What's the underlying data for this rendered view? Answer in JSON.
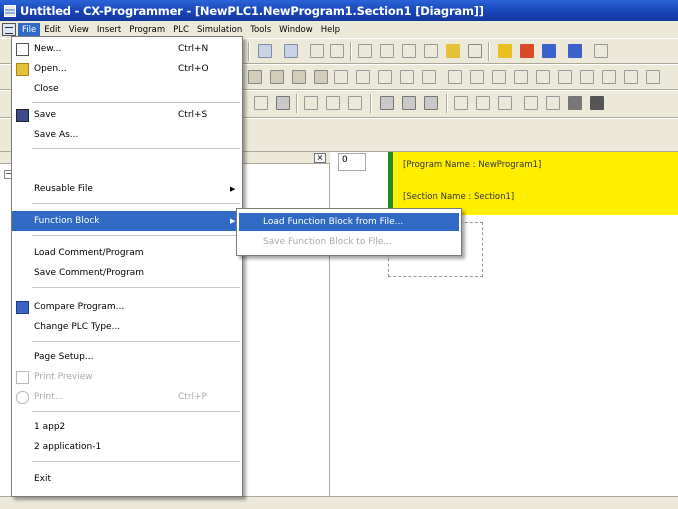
{
  "window": {
    "title": "Untitled - CX-Programmer - [NewPLC1.NewProgram1.Section1 [Diagram]]"
  },
  "menubar": [
    "File",
    "Edit",
    "View",
    "Insert",
    "Program",
    "PLC",
    "Simulation",
    "Tools",
    "Window",
    "Help"
  ],
  "file_menu": {
    "new": {
      "label": "New...",
      "shortcut": "Ctrl+N"
    },
    "open": {
      "label": "Open...",
      "shortcut": "Ctrl+O"
    },
    "close": {
      "label": "Close"
    },
    "save": {
      "label": "Save",
      "shortcut": "Ctrl+S"
    },
    "save_as": {
      "label": "Save As..."
    },
    "reusable_file": {
      "label": "Reusable File"
    },
    "function_block": {
      "label": "Function Block"
    },
    "load_comment": {
      "label": "Load Comment/Program"
    },
    "save_comment": {
      "label": "Save Comment/Program"
    },
    "compare_program": {
      "label": "Compare Program..."
    },
    "change_plc": {
      "label": "Change PLC Type..."
    },
    "page_setup": {
      "label": "Page Setup..."
    },
    "print_preview": {
      "label": "Print Preview"
    },
    "print": {
      "label": "Print...",
      "shortcut": "Ctrl+P"
    },
    "recent_1": {
      "label": "1 app2"
    },
    "recent_2": {
      "label": "2 application-1"
    },
    "exit": {
      "label": "Exit"
    }
  },
  "function_block_submenu": {
    "load": {
      "label": "Load Function Block from File..."
    },
    "save": {
      "label": "Save Function Block to File..."
    }
  },
  "diagram": {
    "rung_number": "0",
    "program_name": "[Program Name : NewProgram1]",
    "section_name": "[Section Name : Section1]"
  },
  "colors": {
    "title_bar": "#1743b4",
    "menu_highlight": "#316ac5",
    "diagram_header": "#ffee00",
    "rung_bar": "#1c8c1c"
  }
}
